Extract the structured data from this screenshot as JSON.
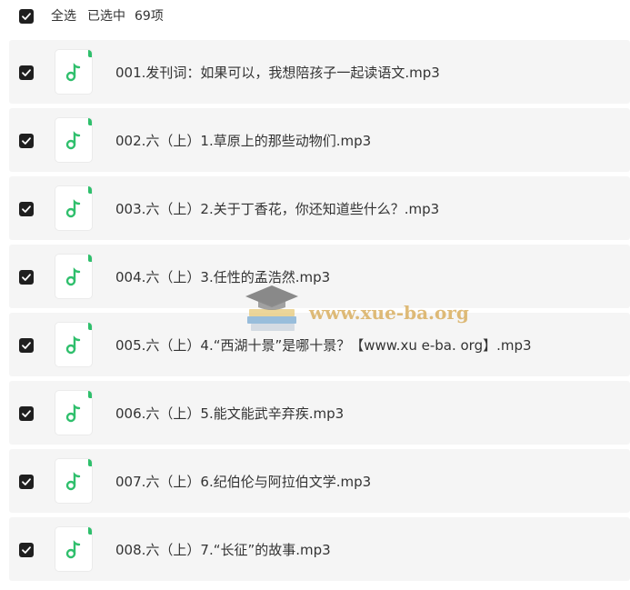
{
  "header": {
    "select_all_label": "全选",
    "selected_prefix": "已选中",
    "selected_count": "69",
    "selected_suffix": "项"
  },
  "files": [
    {
      "name": "001.发刊词：如果可以，我想陪孩子一起读语文.mp3",
      "checked": true
    },
    {
      "name": "002.六（上）1.草原上的那些动物们.mp3",
      "checked": true
    },
    {
      "name": "003.六（上）2.关于丁香花，你还知道些什么？.mp3",
      "checked": true
    },
    {
      "name": "004.六（上）3.任性的孟浩然.mp3",
      "checked": true
    },
    {
      "name": "005.六（上）4.“西湖十景”是哪十景？【www.xu e-ba. org】.mp3",
      "checked": true
    },
    {
      "name": "006.六（上）5.能文能武辛弃疾.mp3",
      "checked": true
    },
    {
      "name": "007.六（上）6.纪伯伦与阿拉伯文学.mp3",
      "checked": true
    },
    {
      "name": "008.六（上）7.“长征”的故事.mp3",
      "checked": true
    }
  ],
  "watermark": {
    "text": "www.xue-ba.org",
    "icon": "graduation-cap-books-icon"
  },
  "colors": {
    "checkbox": "#1f1f1f",
    "row_bg": "#f5f5f5",
    "audio_icon": "#2fbf6c",
    "watermark": "#d6a852"
  },
  "icons": {
    "checkbox": "checkmark-icon",
    "file": "music-note-icon"
  }
}
